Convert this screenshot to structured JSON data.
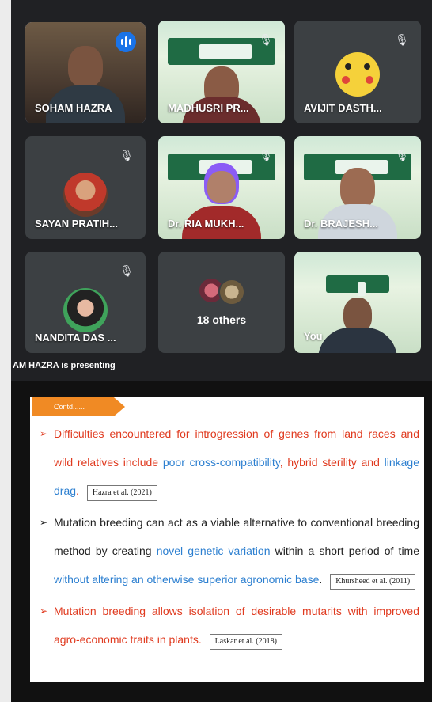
{
  "participants": [
    {
      "name": "SOHAM HAZRA",
      "speaking": true
    },
    {
      "name": "MADHUSRI PR..."
    },
    {
      "name": "AVIJIT DASTH..."
    },
    {
      "name": "SAYAN PRATIH..."
    },
    {
      "name": "Dr. RIA MUKH..."
    },
    {
      "name": "Dr. BRAJESH..."
    },
    {
      "name": "NANDITA DAS ..."
    },
    {
      "name": "18 others"
    },
    {
      "name": "You"
    }
  ],
  "presenting_text": "AM HAZRA is presenting",
  "slide": {
    "tag": "Contd......",
    "bullets": [
      {
        "segments": [
          {
            "t": "Difficulties encountered for introgression of genes from land races and wild relatives include ",
            "c": "red"
          },
          {
            "t": "poor cross-compatibility",
            "c": "blue"
          },
          {
            "t": ", ",
            "c": "red"
          },
          {
            "t": "hybrid sterility",
            "c": "red"
          },
          {
            "t": " and ",
            "c": "red"
          },
          {
            "t": "linkage drag",
            "c": "blue"
          },
          {
            "t": ".",
            "c": "red"
          }
        ],
        "ref": "Hazra et al. (2021)"
      },
      {
        "segments": [
          {
            "t": "Mutation breeding can act as a viable alternative to conventional breeding method by creating ",
            "c": "black"
          },
          {
            "t": "novel genetic variation",
            "c": "blue"
          },
          {
            "t": " within a short period of time ",
            "c": "black"
          },
          {
            "t": "without altering an otherwise superior agronomic base",
            "c": "blue"
          },
          {
            "t": ".",
            "c": "black"
          }
        ],
        "ref": "Khursheed et al. (2011)"
      },
      {
        "segments": [
          {
            "t": "Mutation breeding allows isolation of desirable mutarits with improved agro-economic traits in plants.",
            "c": "red"
          }
        ],
        "ref": "Laskar et al. (2018)"
      }
    ]
  },
  "colors": {
    "accent": "#1a73e8",
    "red_text": "#e03a1f",
    "blue_text": "#2c7fd0",
    "tag": "#f08a24"
  }
}
